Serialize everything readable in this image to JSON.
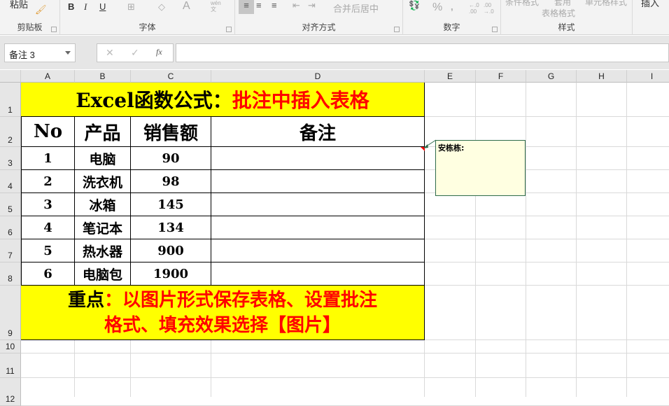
{
  "ribbon": {
    "clipboard": {
      "paste": "粘贴",
      "label": "剪贴板"
    },
    "font": {
      "bold": "B",
      "italic": "I",
      "underline": "U",
      "font_color": "A",
      "phonetic": "wén\n文",
      "label": "字体"
    },
    "alignment": {
      "merge_center": "合并后居中",
      "label": "对齐方式"
    },
    "number": {
      "percent": "%",
      "comma": ",",
      "inc_decimal": "←.0 .00",
      "dec_decimal": ".00 →.0",
      "label": "数字"
    },
    "styles": {
      "conditional": "条件格式",
      "table_format_1": "套用",
      "table_format_2": "表格格式",
      "cell_styles": "单元格样式",
      "label": "样式"
    },
    "cells": {
      "insert": "插入"
    }
  },
  "formula_bar": {
    "name_box": "备注 3",
    "cancel": "✕",
    "enter": "✓",
    "fx": "fx",
    "value": ""
  },
  "columns": [
    "A",
    "B",
    "C",
    "D",
    "E",
    "F",
    "G",
    "H",
    "I"
  ],
  "rows": [
    "1",
    "2",
    "3",
    "4",
    "5",
    "6",
    "7",
    "8",
    "9",
    "10",
    "11",
    "12"
  ],
  "sheet": {
    "title_black": "Excel函数公式：",
    "title_red": "批注中插入表格",
    "headers": [
      "No",
      "产品",
      "销售额",
      "备注"
    ],
    "data": [
      [
        "1",
        "电脑",
        "90",
        ""
      ],
      [
        "2",
        "洗衣机",
        "98",
        ""
      ],
      [
        "3",
        "冰箱",
        "145",
        ""
      ],
      [
        "4",
        "笔记本",
        "134",
        ""
      ],
      [
        "5",
        "热水器",
        "900",
        ""
      ],
      [
        "6",
        "电脑包",
        "1900",
        ""
      ]
    ],
    "note_black": "重点",
    "note_red_1": "：以图片形式保存表格、设置批注",
    "note_red_2": "格式、填充效果选择【图片】"
  },
  "comment": {
    "author": "安栋栋:"
  },
  "colors": {
    "highlight": "#ffff00",
    "accent_red": "#ff0000",
    "comment_bg": "#ffffe1"
  }
}
